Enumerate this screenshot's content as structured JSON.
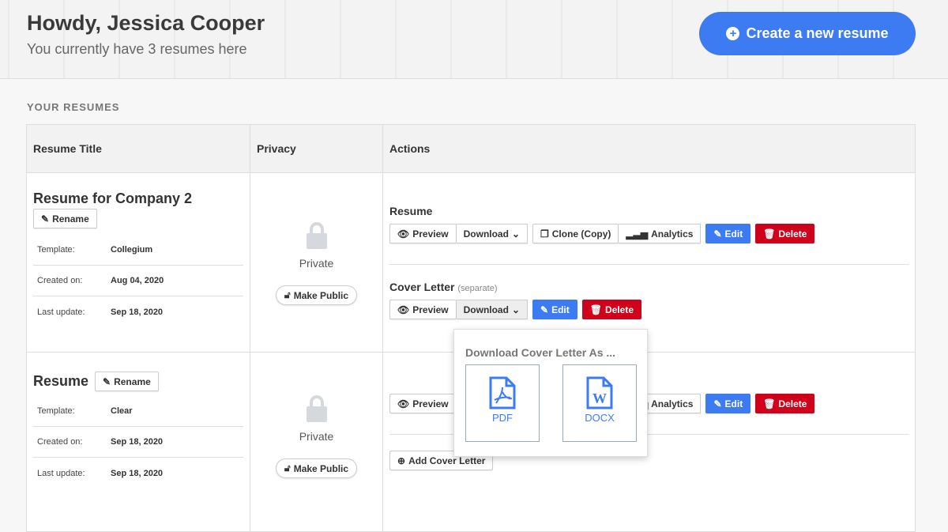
{
  "header": {
    "greeting": "Howdy, Jessica Cooper",
    "subtitle": "You currently have 3 resumes here",
    "create_label": "Create a new resume"
  },
  "section_title": "YOUR RESUMES",
  "columns": [
    "Resume Title",
    "Privacy",
    "Actions"
  ],
  "labels": {
    "rename": "Rename",
    "template": "Template:",
    "created": "Created on:",
    "updated": "Last update:",
    "private": "Private",
    "make_public": "Make Public",
    "resume": "Resume",
    "cover_letter": "Cover Letter",
    "separate": "(separate)",
    "preview": "Preview",
    "download": "Download",
    "clone": "Clone (Copy)",
    "analytics": "Analytics",
    "edit": "Edit",
    "delete": "Delete",
    "add_cover": "Add Cover Letter"
  },
  "resumes": [
    {
      "title": "Resume for Company 2",
      "template": "Collegium",
      "created": "Aug 04, 2020",
      "updated": "Sep 18, 2020"
    },
    {
      "title": "Resume",
      "template": "Clear",
      "created": "Sep 18, 2020",
      "updated": "Sep 18, 2020"
    }
  ],
  "download_popup": {
    "title": "Download Cover Letter As ...",
    "options": [
      "PDF",
      "DOCX"
    ]
  },
  "colors": {
    "primary": "#3d7bf3",
    "danger": "#d0021b"
  }
}
